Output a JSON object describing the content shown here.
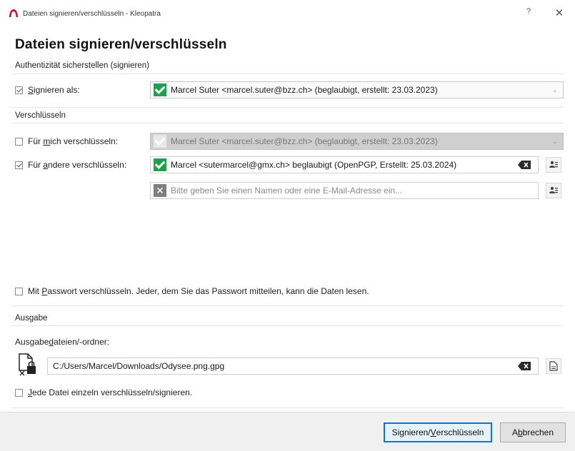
{
  "window": {
    "title": "Dateien signieren/verschlüsseln - Kleopatra",
    "help_label": "?",
    "close_label": "✕"
  },
  "page_title": "Dateien signieren/verschlüsseln",
  "sign_section": {
    "label": "Authentizität sicherstellen (signieren)",
    "sign_as": {
      "checked": true,
      "label_pre": "",
      "label_acc": "S",
      "label_post": "ignieren als:",
      "value": "Marcel Suter <marcel.suter@bzz.ch> (beglaubigt, erstellt: 23.03.2023)"
    }
  },
  "encrypt_section": {
    "label": "Verschlüsseln",
    "for_me": {
      "checked": false,
      "label_pre": "Für ",
      "label_acc": "m",
      "label_post": "ich verschlüsseln:",
      "value": "Marcel Suter <marcel.suter@bzz.ch> (beglaubigt, erstellt: 23.03.2023)"
    },
    "for_others": {
      "checked": true,
      "label_pre": "Für ",
      "label_acc": "a",
      "label_post": "ndere verschlüsseln:",
      "recipient_value": "Marcel <sutermarcel@gmx.ch> beglaubigt (OpenPGP, Erstellt: 25.03.2024)",
      "new_recipient_placeholder": "Bitte geben Sie einen Namen oder eine E-Mail-Adresse ein..."
    },
    "password": {
      "checked": false,
      "label_pre": "Mit ",
      "label_acc": "P",
      "label_post": "asswort verschlüsseln. Jeder, dem Sie das Passwort mitteilen, kann die Daten lesen."
    }
  },
  "output_section": {
    "label": "Ausgabe",
    "files_label_pre": "Ausgabe",
    "files_label_acc": "d",
    "files_label_post": "ateien/-ordner:",
    "path_value": "C:/Users/Marcel/Downloads/Odysee.png.gpg",
    "each_file": {
      "checked": false,
      "label_pre": "",
      "label_acc": "J",
      "label_post": "ede Datei einzeln verschlüsseln/signieren."
    }
  },
  "buttons": {
    "submit_pre": "Signieren/",
    "submit_acc": "V",
    "submit_post": "erschlüsseln",
    "cancel_pre": "A",
    "cancel_acc": "b",
    "cancel_post": "brechen"
  },
  "colors": {
    "cert_valid": "#1aa34a",
    "cert_invalid": "#7f7f7f",
    "primary_border": "#0078d7"
  }
}
